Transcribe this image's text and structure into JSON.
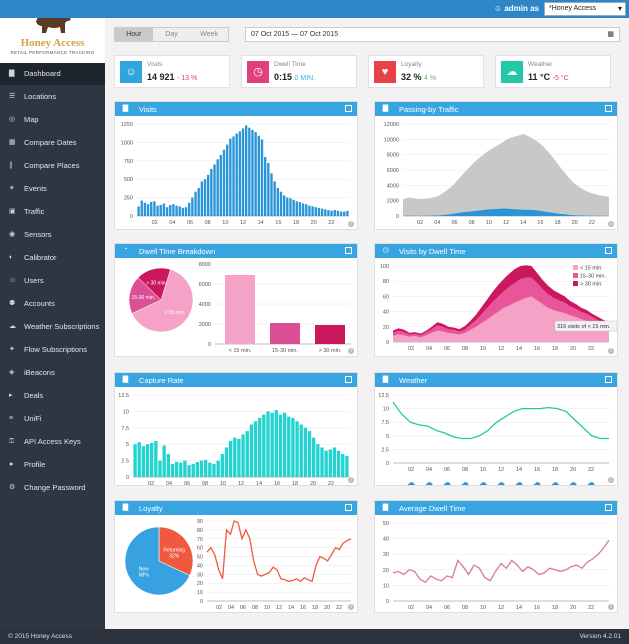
{
  "header": {
    "admin_label": "admin as",
    "site_select": "*Honey Access"
  },
  "logo": {
    "title": "Honey Access",
    "subtitle": "RETAIL PERFORMANCE TRACKING"
  },
  "nav": [
    {
      "label": "Dashboard",
      "icon": "bar-chart-icon"
    },
    {
      "label": "Locations",
      "icon": "list-icon"
    },
    {
      "label": "Map",
      "icon": "globe-icon"
    },
    {
      "label": "Compare Dates",
      "icon": "calendar-icon"
    },
    {
      "label": "Compare Places",
      "icon": "columns-icon"
    },
    {
      "label": "Events",
      "icon": "events-icon"
    },
    {
      "label": "Traffic",
      "icon": "car-icon"
    },
    {
      "label": "Sensors",
      "icon": "sensor-icon"
    },
    {
      "label": "Calibrator",
      "icon": "calibrator-icon"
    },
    {
      "label": "Users",
      "icon": "user-icon"
    },
    {
      "label": "Accounts",
      "icon": "users-icon"
    },
    {
      "label": "Weather Subscriptions",
      "icon": "cloud-icon"
    },
    {
      "label": "Flow Subscriptions",
      "icon": "flow-icon"
    },
    {
      "label": "iBeacons",
      "icon": "beacon-icon"
    },
    {
      "label": "Deals",
      "icon": "tag-icon"
    },
    {
      "label": "UniFi",
      "icon": "wifi-icon"
    },
    {
      "label": "API Access Keys",
      "icon": "key-icon"
    },
    {
      "label": "Profile",
      "icon": "profile-icon"
    },
    {
      "label": "Change Password",
      "icon": "gear-icon"
    }
  ],
  "toolbar": {
    "periods": [
      "Hour",
      "Day",
      "Week"
    ],
    "selected_period": "Hour",
    "date_range": "07 Oct 2015 — 07 Oct 2015"
  },
  "kpis": [
    {
      "label": "Visits",
      "value": "14 921",
      "delta": "- 13 %",
      "color": "#2fa4df",
      "icon": "person-icon",
      "delta_color": "#e0415a"
    },
    {
      "label": "Dwell Time",
      "value": "0:15",
      "delta": "0 MIN.",
      "color": "#e0407c",
      "icon": "clock-icon",
      "delta_color": "#35b6e0"
    },
    {
      "label": "Loyalty",
      "value": "32 %",
      "delta": "4 %",
      "color": "#e84147",
      "icon": "heart-icon",
      "delta_color": "#5cb85c"
    },
    {
      "label": "Weather",
      "value": "11 °C",
      "delta": "-5 °C",
      "color": "#22c9a4",
      "icon": "weather-icon",
      "delta_color": "#e0415a"
    }
  ],
  "panels": {
    "visits": "Visits",
    "passing": "Passing-by Traffic",
    "dwell_breakdown": "Dwell Time Breakdown",
    "visits_dwell": "Visits by Dwell Time",
    "capture": "Capture Rate",
    "weather": "Weather",
    "loyalty": "Loyalty",
    "avg_dwell": "Average Dwell Time"
  },
  "chart_data": [
    {
      "type": "bar",
      "name": "visits",
      "x_ticks": [
        "02",
        "04",
        "06",
        "08",
        "10",
        "12",
        "14",
        "16",
        "18",
        "20",
        "22"
      ],
      "yticks": [
        0,
        250,
        500,
        750,
        1000,
        1250
      ],
      "ylim": [
        0,
        1250
      ],
      "values": [
        130,
        210,
        180,
        160,
        190,
        200,
        140,
        150,
        170,
        120,
        150,
        160,
        140,
        130,
        110,
        120,
        180,
        250,
        330,
        380,
        470,
        500,
        560,
        640,
        700,
        770,
        830,
        900,
        970,
        1050,
        1080,
        1120,
        1150,
        1190,
        1230,
        1200,
        1170,
        1140,
        1090,
        1040,
        800,
        720,
        580,
        470,
        380,
        330,
        280,
        250,
        240,
        220,
        200,
        190,
        170,
        160,
        140,
        130,
        120,
        110,
        100,
        90,
        80,
        70,
        80,
        70,
        60,
        60,
        70
      ]
    },
    {
      "type": "area",
      "name": "passing",
      "x_ticks": [
        "02",
        "04",
        "06",
        "08",
        "10",
        "12",
        "14",
        "16",
        "18",
        "20",
        "22"
      ],
      "yticks": [
        0,
        2000,
        4000,
        6000,
        8000,
        10000,
        12000
      ],
      "ylim": [
        0,
        12000
      ],
      "series": [
        {
          "values": [
            2200,
            2400,
            2350,
            2200,
            2250,
            2300,
            2400,
            2600,
            3000,
            3500,
            4000,
            4800,
            5500,
            6200,
            6900,
            7500,
            8000,
            8500,
            8900,
            9300,
            9700,
            10100,
            10300,
            10500,
            10700,
            10400,
            10000,
            9600,
            9000,
            8300,
            7500,
            6600,
            5800,
            5000,
            4300,
            3800,
            3400,
            3100,
            2900,
            2700,
            2600,
            2500
          ]
        },
        {
          "values": [
            40,
            50,
            40,
            30,
            40,
            50,
            60,
            80,
            120,
            200,
            300,
            400,
            500,
            560,
            620,
            700,
            780,
            860,
            900,
            920,
            980,
            950,
            900,
            850,
            820,
            800,
            780,
            700,
            600,
            500,
            400,
            300,
            220,
            150,
            100,
            70,
            60,
            50,
            40,
            40,
            30,
            30
          ]
        }
      ]
    },
    {
      "type": "pie",
      "name": "dwell_pie",
      "labels": [
        "< 15 min.",
        "15-30 min.",
        "> 30 min."
      ],
      "values": [
        6900,
        2100,
        1900
      ],
      "colors": [
        "#f4a3c7",
        "#dc4f95",
        "#c9185c"
      ]
    },
    {
      "type": "bar",
      "name": "dwell_bars",
      "categories": [
        "< 15 min.",
        "15-30 min.",
        "> 30 min."
      ],
      "values": [
        6900,
        2100,
        1900
      ],
      "yticks": [
        0,
        2000,
        4000,
        6000,
        8000
      ],
      "ylim": [
        0,
        8000
      ],
      "colors": [
        "#f4a3c7",
        "#dc4f95",
        "#c9185c"
      ]
    },
    {
      "type": "area",
      "name": "visits_dwell",
      "x_ticks": [
        "02",
        "04",
        "06",
        "08",
        "10",
        "12",
        "14",
        "16",
        "18",
        "20",
        "22"
      ],
      "yticks": [
        0,
        20,
        40,
        60,
        80,
        100
      ],
      "ylim": [
        0,
        100
      ],
      "legend": [
        "< 15 min.",
        "15-30 min.",
        "> 30 min."
      ],
      "tooltip": "316 visits of < 15 min.",
      "series": [
        {
          "values": [
            8,
            10,
            9,
            7,
            8,
            6,
            9,
            12,
            15,
            14,
            12,
            11,
            10,
            12,
            16,
            20,
            25,
            30,
            35,
            40,
            45,
            48,
            52,
            55,
            58,
            60,
            55,
            50,
            45,
            42,
            40,
            38,
            35,
            33,
            30,
            28,
            25,
            22,
            20,
            18
          ]
        },
        {
          "values": [
            4,
            5,
            4,
            3,
            3,
            3,
            4,
            5,
            7,
            6,
            5,
            5,
            4,
            5,
            7,
            9,
            12,
            15,
            18,
            20,
            22,
            25,
            26,
            28,
            27,
            25,
            23,
            20,
            18,
            16,
            15,
            14,
            12,
            11,
            10,
            9,
            8,
            7,
            6,
            5
          ]
        },
        {
          "values": [
            3,
            3,
            3,
            2,
            2,
            2,
            2,
            3,
            4,
            4,
            3,
            3,
            3,
            4,
            5,
            7,
            9,
            11,
            13,
            15,
            16,
            17,
            18,
            17,
            16,
            15,
            13,
            12,
            11,
            10,
            9,
            8,
            7,
            6,
            5,
            5,
            4,
            4,
            3,
            3
          ]
        }
      ]
    },
    {
      "type": "bar",
      "name": "capture",
      "x_ticks": [
        "02",
        "04",
        "06",
        "08",
        "10",
        "12",
        "14",
        "16",
        "18",
        "20",
        "22"
      ],
      "yticks": [
        0,
        2.5,
        5,
        7.5,
        10,
        12.5
      ],
      "ylim": [
        0,
        12.5
      ],
      "values": [
        5,
        5.3,
        4.7,
        5,
        5.2,
        5.5,
        2.5,
        4.8,
        3.5,
        2,
        2.3,
        2.2,
        2.5,
        1.8,
        2,
        2.3,
        2.5,
        2.6,
        2.2,
        2,
        2.5,
        3.5,
        4.5,
        5.5,
        6,
        5.8,
        6.5,
        7,
        8,
        8.5,
        9,
        9.5,
        10,
        9.8,
        10.2,
        9.5,
        9.8,
        9.2,
        9,
        8.5,
        8,
        7.5,
        7,
        6,
        5,
        4.5,
        4,
        4.2,
        4.5,
        4,
        3.5,
        3.2
      ]
    },
    {
      "type": "line",
      "name": "weather",
      "x_ticks": [
        "02",
        "04",
        "06",
        "08",
        "10",
        "12",
        "14",
        "16",
        "18",
        "20",
        "22"
      ],
      "yticks": [
        0,
        2.5,
        5,
        7.5,
        10,
        12.5
      ],
      "ylim": [
        0,
        12.5
      ],
      "values": [
        11.2,
        9,
        7.5,
        7,
        6.8,
        6,
        5.5,
        4.8,
        4.5,
        4.5,
        5,
        6,
        7.5,
        8.5,
        9.5,
        10,
        10,
        10,
        10.2,
        10,
        9.5,
        8,
        6.5,
        5,
        4.5,
        4.5
      ]
    },
    {
      "type": "pie",
      "name": "loyalty_pie",
      "labels": [
        "Returning 32%",
        "New 68%"
      ],
      "values": [
        32,
        68
      ],
      "colors": [
        "#f0593f",
        "#36a2e0"
      ]
    },
    {
      "type": "line",
      "name": "loyalty_line",
      "x_ticks": [
        "02",
        "04",
        "06",
        "08",
        "10",
        "12",
        "14",
        "16",
        "18",
        "20",
        "22"
      ],
      "yticks": [
        0,
        10,
        20,
        30,
        40,
        50,
        60,
        70,
        80,
        90
      ],
      "ylim": [
        0,
        90
      ],
      "values": [
        55,
        60,
        52,
        35,
        25,
        80,
        75,
        90,
        88,
        70,
        80,
        70,
        45,
        30,
        28,
        30,
        32,
        38,
        35,
        25,
        24,
        22,
        23,
        25,
        22,
        26,
        24,
        22,
        40,
        50,
        48,
        45,
        52,
        60,
        58,
        65,
        68,
        70
      ]
    },
    {
      "type": "line",
      "name": "avg_dwell",
      "x_ticks": [
        "02",
        "04",
        "06",
        "08",
        "10",
        "12",
        "14",
        "16",
        "18",
        "20",
        "22"
      ],
      "yticks": [
        0,
        10,
        20,
        30,
        40,
        50
      ],
      "ylim": [
        0,
        50
      ],
      "values": [
        18,
        19,
        17,
        20,
        19,
        14,
        12,
        16,
        14,
        13,
        16,
        15,
        26,
        22,
        17,
        23,
        21,
        15,
        13,
        19,
        24,
        21,
        26,
        23,
        19,
        22,
        20,
        17,
        18,
        21,
        20,
        19,
        20,
        22,
        23,
        21,
        25,
        27,
        30,
        34,
        39
      ]
    }
  ],
  "footer": {
    "copyright": "© 2015 Honey Access",
    "version": "Version 4.2.01"
  }
}
